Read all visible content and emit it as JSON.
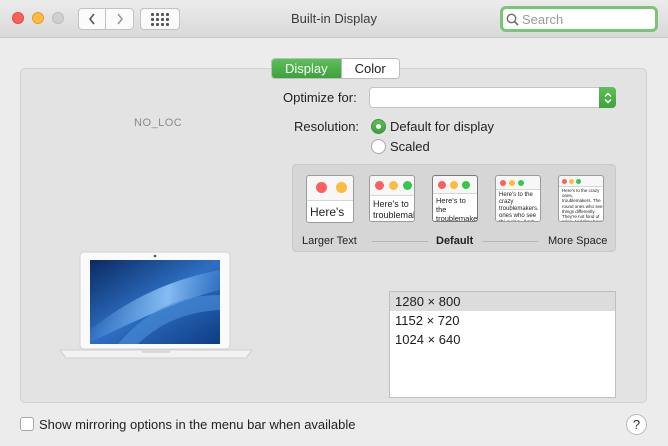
{
  "window": {
    "title": "Built-in Display",
    "search_placeholder": "Search"
  },
  "tabs": [
    {
      "label": "Display",
      "active": true
    },
    {
      "label": "Color",
      "active": false
    }
  ],
  "display_name_placeholder": "NO_LOC",
  "optimize": {
    "label": "Optimize for:",
    "value": ""
  },
  "resolution": {
    "label": "Resolution:",
    "options": [
      {
        "label": "Default for display",
        "selected": true
      },
      {
        "label": "Scaled",
        "selected": false
      }
    ]
  },
  "scaling": {
    "options": [
      {
        "sample_text": "Here's"
      },
      {
        "sample_text": "Here's to troublemak"
      },
      {
        "sample_text": "Here's to the troublemakers. ones who see t"
      },
      {
        "sample_text": "Here's to the crazy troublemakers. ones who see thi rules. And they"
      },
      {
        "sample_text": "Here's to the crazy ones, troublemakers. The round ones who see things differently. They're not fond of rules. And they have no respect for the status quo. You can quote them, disagree with them, glorify or vilify them. About the only thing you can't do is ignore them. Because they change things."
      }
    ],
    "left_label": "Larger Text",
    "center_label": "Default",
    "right_label": "More Space"
  },
  "resolutions_list": [
    {
      "label": "1280 × 800",
      "selected": true
    },
    {
      "label": "1152 × 720",
      "selected": false
    },
    {
      "label": "1024 × 640",
      "selected": false
    }
  ],
  "mirroring": {
    "label": "Show mirroring options in the menu bar when available",
    "checked": false
  },
  "help_label": "?",
  "colors": {
    "accent_green": "#3ea13b",
    "search_focus_ring": "#7cc576",
    "close_red": "#fc605c",
    "minimize_yellow": "#fdbc40"
  }
}
